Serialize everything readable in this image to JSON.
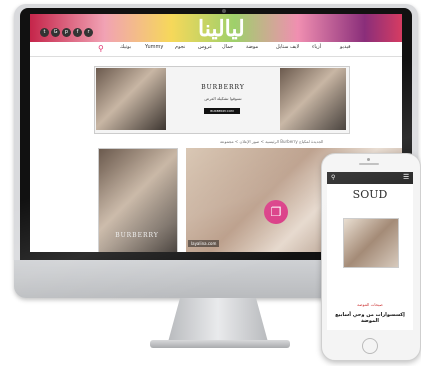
{
  "site": {
    "logo": "ليالينا",
    "nav": [
      "فيديو",
      "أزياء",
      "لايف ستايل",
      "موضة",
      "جمال",
      "عروس",
      "نجوم",
      "Yummy",
      "بوتيك"
    ]
  },
  "ad": {
    "brand": "BURBERRY",
    "tagline": "تسوقوا تشكيلة العرض",
    "button": "BURBERRY.COM"
  },
  "breadcrumb": "الرئيسية > صور الإعلان > مجموعة Burberry الجديدة لمكياج",
  "article": {
    "tall_brand": "BURBERRY",
    "caption": "layalina.com"
  },
  "phone": {
    "logo": "SOUD",
    "category": "صيحات الموضة",
    "title": "إكسسوارات من وحي أسابيع الموضة"
  },
  "colors": {
    "accent": "#d93682",
    "banner": "#c5254a"
  }
}
